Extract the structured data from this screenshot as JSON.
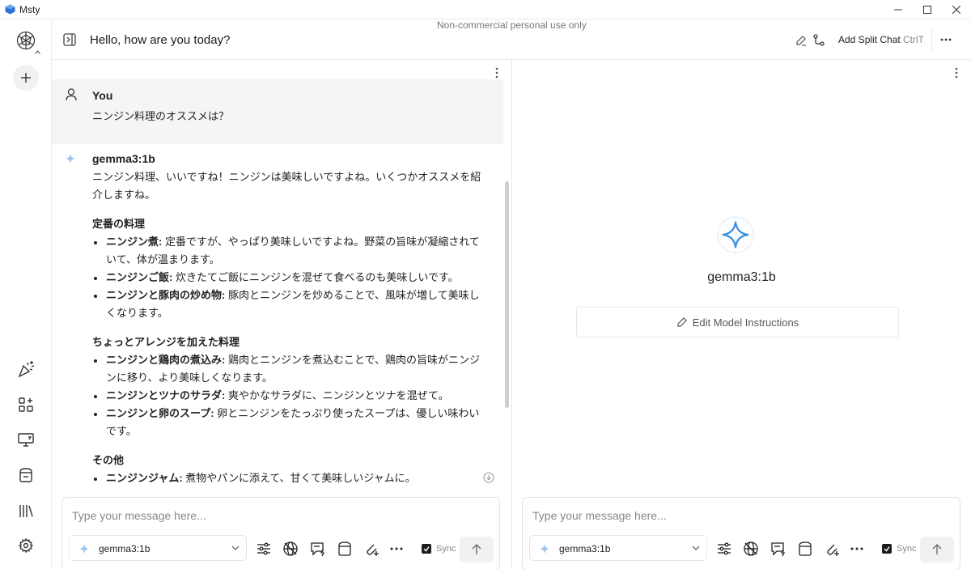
{
  "window": {
    "title": "Msty",
    "notice": "Non-commercial personal use only"
  },
  "header": {
    "chat_title": "Hello, how are you today?",
    "split_label": "Add Split Chat",
    "split_shortcut": "CtrlT"
  },
  "left_pane": {
    "user": {
      "name": "You",
      "text": "ニンジン料理のオススメは？"
    },
    "assistant": {
      "name": "gemma3:1b",
      "intro": "ニンジン料理、いいですね！ニンジンは美味しいですよね。いくつかオススメを紹介しますね。",
      "sections": [
        {
          "heading": "定番の料理",
          "items": [
            {
              "bold": "ニンジン煮:",
              "text": " 定番ですが、やっぱり美味しいですよね。野菜の旨味が凝縮されていて、体が温まります。"
            },
            {
              "bold": "ニンジンご飯:",
              "text": " 炊きたてご飯にニンジンを混ぜて食べるのも美味しいです。"
            },
            {
              "bold": "ニンジンと豚肉の炒め物:",
              "text": " 豚肉とニンジンを炒めることで、風味が増して美味しくなります。"
            }
          ]
        },
        {
          "heading": "ちょっとアレンジを加えた料理",
          "items": [
            {
              "bold": "ニンジンと鶏肉の煮込み:",
              "text": " 鶏肉とニンジンを煮込むことで、鶏肉の旨味がニンジンに移り、より美味しくなります。"
            },
            {
              "bold": "ニンジンとツナのサラダ:",
              "text": " 爽やかなサラダに、ニンジンとツナを混ぜて。"
            },
            {
              "bold": "ニンジンと卵のスープ:",
              "text": " 卵とニンジンをたっぷり使ったスープは、優しい味わいです。"
            }
          ]
        },
        {
          "heading": "その他",
          "items": [
            {
              "bold": "ニンジンジャム:",
              "text": " 煮物やパンに添えて、甘くて美味しいジャムに。"
            }
          ]
        }
      ]
    },
    "composer": {
      "placeholder": "Type your message here...",
      "model": "gemma3:1b",
      "sync_label": "Sync"
    }
  },
  "right_pane": {
    "model_name": "gemma3:1b",
    "edit_instructions": "Edit Model Instructions",
    "composer": {
      "placeholder": "Type your message here...",
      "model": "gemma3:1b",
      "sync_label": "Sync"
    }
  },
  "colors": {
    "accent": "#3b8fe0",
    "muted_bg": "#f5f5f5",
    "border": "#e3e3e3"
  }
}
